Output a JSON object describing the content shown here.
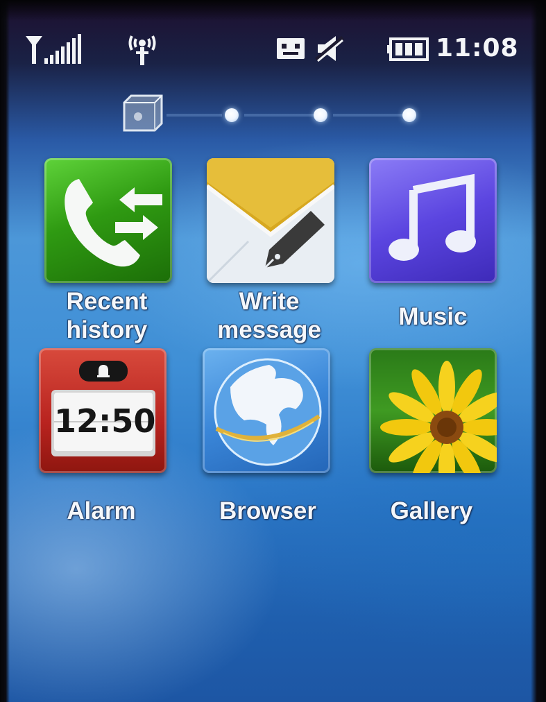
{
  "status_bar": {
    "time": "11:08",
    "icons": [
      "signal-strength-icon",
      "gps-icon",
      "message-icon",
      "mute-icon",
      "battery-icon"
    ],
    "signal_bars": 5
  },
  "pages": {
    "count": 4,
    "current": 1
  },
  "apps": [
    {
      "name": "Recent history",
      "label": "Recent\nhistory",
      "icon": "call-history-icon",
      "color": "#2f9a12"
    },
    {
      "name": "Write message",
      "label": "Write\nmessage",
      "icon": "envelope-pen-icon",
      "color": "#e8b92a"
    },
    {
      "name": "Music",
      "label": "Music",
      "icon": "music-note-icon",
      "color": "#5b45e0"
    },
    {
      "name": "Alarm",
      "label": "Alarm",
      "icon": "alarm-clock-icon",
      "color": "#b8231f",
      "time": "12:50"
    },
    {
      "name": "Browser",
      "label": "Browser",
      "icon": "globe-icon",
      "color": "#3a86d8"
    },
    {
      "name": "Gallery",
      "label": "Gallery",
      "icon": "flower-photo-icon",
      "color": "#2a7a18"
    }
  ]
}
